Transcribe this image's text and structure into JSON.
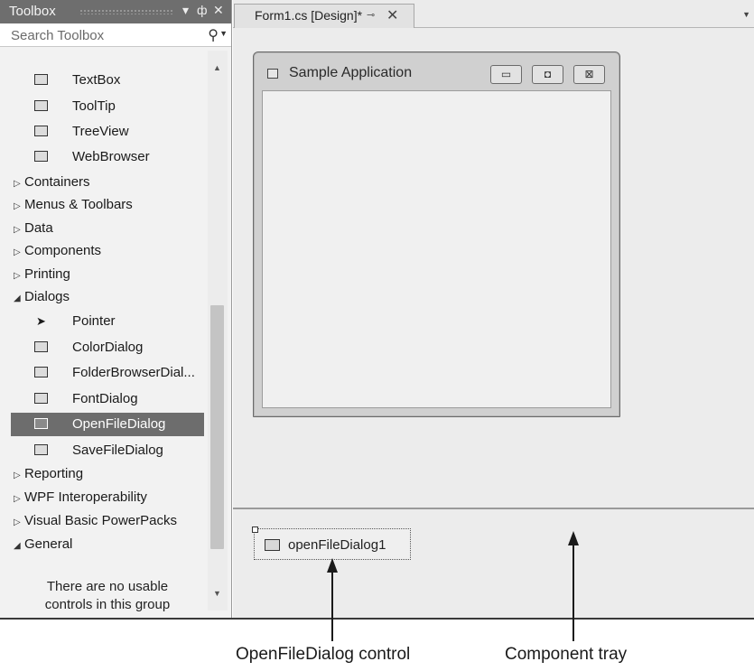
{
  "toolbox": {
    "title": "Toolbox",
    "title_controls": {
      "dropdown": "▾",
      "pin": "ᵖ",
      "close": "✕"
    },
    "search_placeholder": "Search Toolbox",
    "items_top": [
      {
        "label": "TextBox",
        "icon": "textbox-icon"
      },
      {
        "label": "ToolTip",
        "icon": "tooltip-icon"
      },
      {
        "label": "TreeView",
        "icon": "treeview-icon"
      },
      {
        "label": "WebBrowser",
        "icon": "webbrowser-icon"
      }
    ],
    "categories_collapsed": [
      {
        "label": "Containers",
        "arrow": "▷"
      },
      {
        "label": "Menus & Toolbars",
        "arrow": "▷"
      },
      {
        "label": "Data",
        "arrow": "▷"
      },
      {
        "label": "Components",
        "arrow": "▷"
      },
      {
        "label": "Printing",
        "arrow": "▷"
      }
    ],
    "dialogs_category": {
      "label": "Dialogs",
      "arrow": "◢"
    },
    "dialog_items": [
      {
        "label": "Pointer",
        "icon": "pointer-icon"
      },
      {
        "label": "ColorDialog",
        "icon": "colordialog-icon"
      },
      {
        "label": "FolderBrowserDial...",
        "icon": "folderbrowserdialog-icon"
      },
      {
        "label": "FontDialog",
        "icon": "fontdialog-icon"
      },
      {
        "label": "OpenFileDialog",
        "icon": "openfiledialog-icon",
        "selected": true
      },
      {
        "label": "SaveFileDialog",
        "icon": "savefiledialog-icon"
      }
    ],
    "categories_after": [
      {
        "label": "Reporting",
        "arrow": "▷"
      },
      {
        "label": "WPF Interoperability",
        "arrow": "▷"
      },
      {
        "label": "Visual Basic PowerPacks",
        "arrow": "▷"
      },
      {
        "label": "General",
        "arrow": "◢"
      }
    ],
    "empty_message_line1": "There are no usable",
    "empty_message_line2": "controls in this group"
  },
  "tab": {
    "label": "Form1.cs [Design]*",
    "pin": "⊸",
    "close": "✕"
  },
  "form": {
    "title": "Sample Application",
    "minimize": "▭",
    "maximize": "◘",
    "close": "⊠"
  },
  "tray": {
    "component_label": "openFileDialog1"
  },
  "callouts": {
    "left": "OpenFileDialog control",
    "right": "Component tray"
  }
}
